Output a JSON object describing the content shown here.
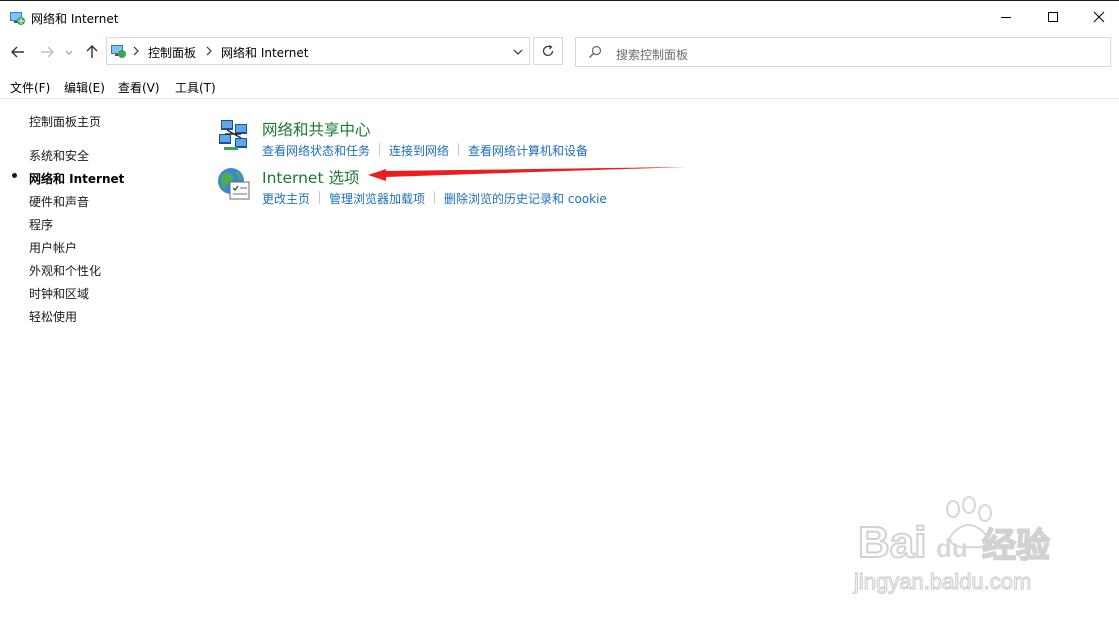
{
  "window": {
    "title": "网络和 Internet",
    "controls": [
      "minimize-icon",
      "maximize-icon",
      "close-icon"
    ]
  },
  "navigation": {
    "breadcrumbs": [
      "控制面板",
      "网络和 Internet"
    ],
    "search_placeholder": "搜索控制面板",
    "icons": [
      "back-arrow-icon",
      "forward-arrow-icon",
      "recent-dropdown-icon",
      "up-arrow-icon",
      "refresh-icon",
      "search-icon"
    ]
  },
  "menubar": {
    "items": [
      "文件(F)",
      "编辑(E)",
      "查看(V)",
      "工具(T)"
    ]
  },
  "sidebar": {
    "items": [
      {
        "label": "控制面板主页",
        "active": false
      },
      {
        "label": "系统和安全",
        "active": false
      },
      {
        "label": "网络和 Internet",
        "active": true
      },
      {
        "label": "硬件和声音",
        "active": false
      },
      {
        "label": "程序",
        "active": false
      },
      {
        "label": "用户帐户",
        "active": false
      },
      {
        "label": "外观和个性化",
        "active": false
      },
      {
        "label": "时钟和区域",
        "active": false
      },
      {
        "label": "轻松使用",
        "active": false
      }
    ]
  },
  "categories": [
    {
      "title": "网络和共享中心",
      "icon": "network-sharing-icon",
      "links": [
        "查看网络状态和任务",
        "连接到网络",
        "查看网络计算机和设备"
      ]
    },
    {
      "title": "Internet 选项",
      "icon": "internet-options-icon",
      "links": [
        "更改主页",
        "管理浏览器加载项",
        "删除浏览的历史记录和 cookie"
      ]
    }
  ],
  "annotation": {
    "icon": "red-arrow-icon",
    "color": "#ee1c1c"
  },
  "watermark": {
    "brand": "Bai du 经验",
    "url": "jingyan.baidu.com"
  },
  "colors": {
    "category_title": "#1a7a2c",
    "link": "#1d6fb8"
  }
}
